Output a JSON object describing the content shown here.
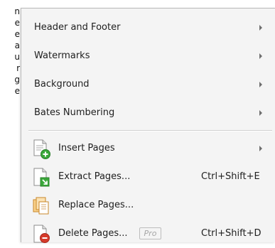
{
  "background_text": [
    "n",
    "e",
    "e",
    "a",
    "u",
    "r",
    "g",
    "e"
  ],
  "menu": {
    "items": [
      {
        "label": "Header and Footer",
        "submenu": true
      },
      {
        "label": "Watermarks",
        "submenu": true
      },
      {
        "label": "Background",
        "submenu": true
      },
      {
        "label": "Bates Numbering",
        "submenu": true
      },
      {
        "label": "Insert Pages",
        "submenu": true,
        "icon": "insert-pages-icon"
      },
      {
        "label": "Extract Pages...",
        "shortcut": "Ctrl+Shift+E",
        "icon": "extract-pages-icon"
      },
      {
        "label": "Replace Pages...",
        "icon": "replace-pages-icon"
      },
      {
        "label": "Delete Pages...",
        "badge": "Pro",
        "shortcut": "Ctrl+Shift+D",
        "icon": "delete-pages-icon"
      }
    ]
  },
  "colors": {
    "menu_background": "#f4f4f4",
    "icon_green": "#3aa83a",
    "icon_orange": "#e8a33a",
    "icon_red": "#d63a2a"
  }
}
